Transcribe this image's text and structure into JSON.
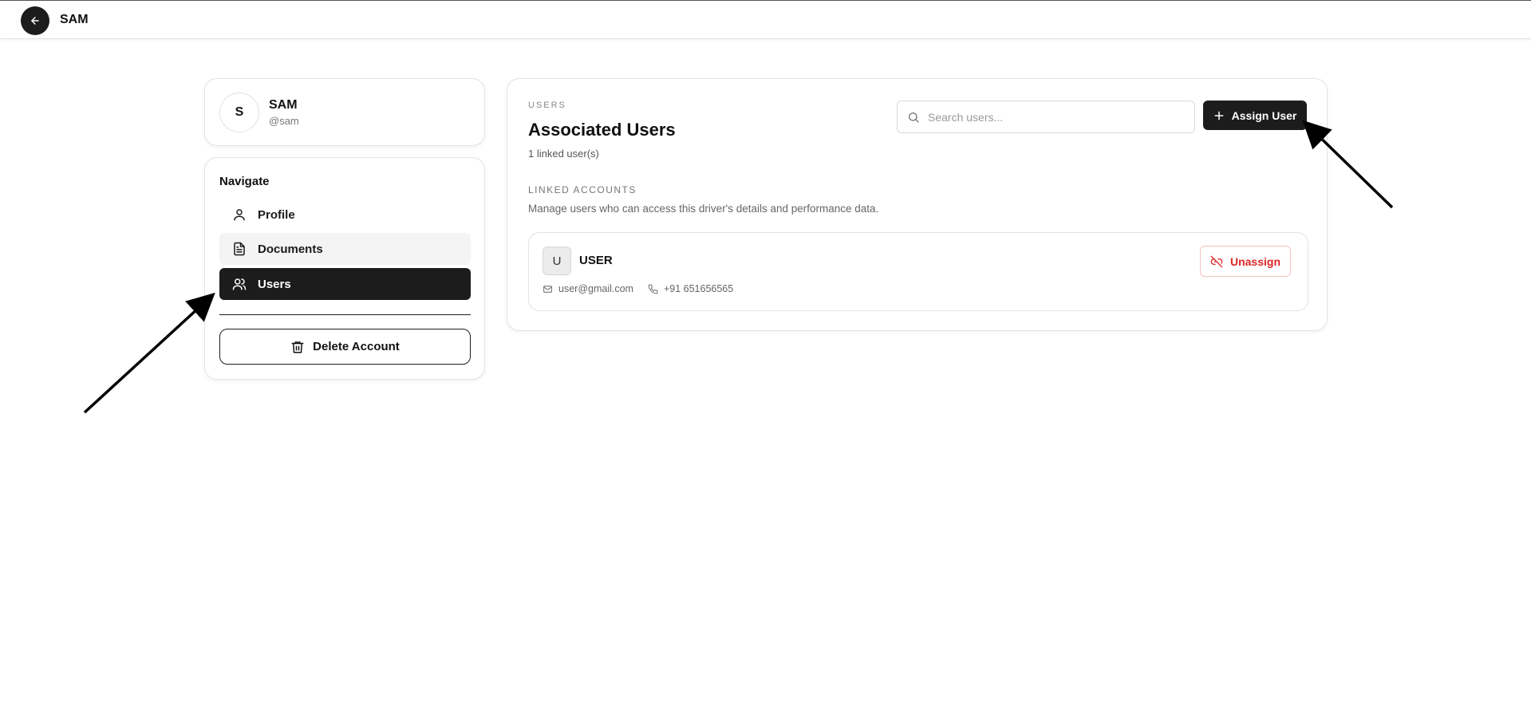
{
  "header": {
    "title": "SAM",
    "back_icon": "arrow-left-icon"
  },
  "profile": {
    "initial": "S",
    "name": "SAM",
    "handle": "@sam"
  },
  "navigation": {
    "title": "Navigate",
    "items": [
      {
        "label": "Profile",
        "icon": "user-icon",
        "active": false
      },
      {
        "label": "Documents",
        "icon": "document-icon",
        "active": false
      },
      {
        "label": "Users",
        "icon": "users-icon",
        "active": true
      }
    ],
    "delete_label": "Delete Account"
  },
  "users_panel": {
    "eyebrow": "USERS",
    "title": "Associated Users",
    "count_text": "1 linked user(s)",
    "search_placeholder": "Search users...",
    "search_value": "",
    "assign_label": "Assign User",
    "section_label": "LINKED ACCOUNTS",
    "section_description": "Manage users who can access this driver's details and performance data.",
    "linked_users": [
      {
        "initial": "U",
        "name": "USER",
        "email": "user@gmail.com",
        "phone": "+91 651656565",
        "action_label": "Unassign"
      }
    ]
  },
  "colors": {
    "dark": "#1c1c1c",
    "danger": "#dc2626",
    "muted": "#888888"
  }
}
